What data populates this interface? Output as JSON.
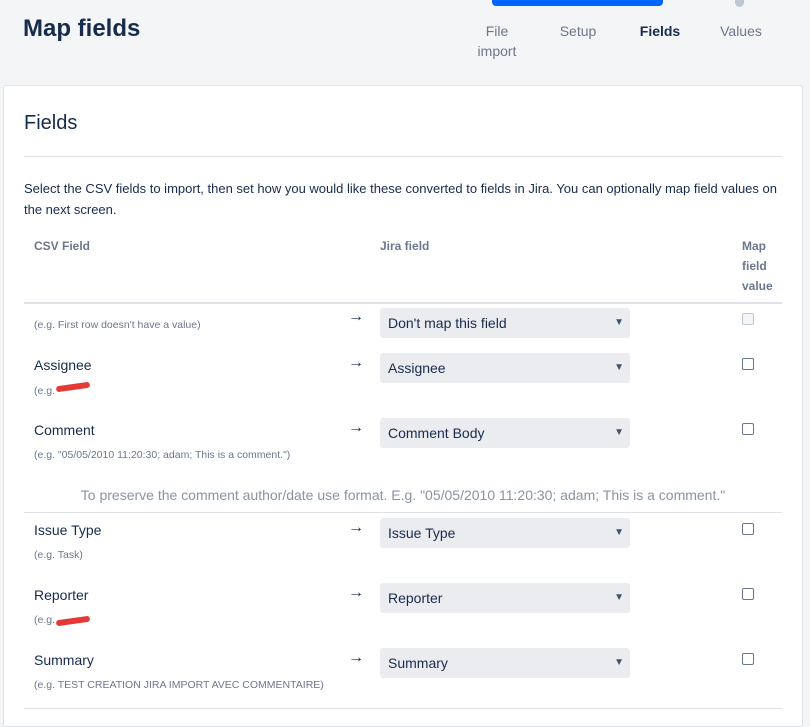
{
  "header": {
    "title": "Map fields",
    "steps": [
      {
        "label_line1": "File",
        "label_line2": "import"
      },
      {
        "label": "Setup"
      },
      {
        "label": "Fields"
      },
      {
        "label": "Values"
      }
    ]
  },
  "section": {
    "title": "Fields",
    "description": "Select the CSV fields to import, then set how you would like these converted to fields in Jira. You can optionally map field values on the next screen."
  },
  "table": {
    "headers": {
      "csv_field": "CSV Field",
      "jira_field": "Jira field",
      "map_value_line1": "Map",
      "map_value_line2": "field",
      "map_value_line3": "value"
    },
    "arrow": "→",
    "rows": [
      {
        "name": "",
        "example": "(e.g. First row doesn't have a value)",
        "mapping": "Don't map this field",
        "map_value": false,
        "disabled": true
      },
      {
        "name": "Assignee",
        "example": "(e.g.",
        "mapping": "Assignee",
        "map_value": false
      },
      {
        "name": "Comment",
        "example": "(e.g. \"05/05/2010 11:20:30; adam; This is a comment.\")",
        "mapping": "Comment Body",
        "map_value": false
      },
      {
        "name": "Issue Type",
        "example": "(e.g. Task)",
        "mapping": "Issue Type",
        "map_value": false
      },
      {
        "name": "Reporter",
        "example": "(e.g.",
        "mapping": "Reporter",
        "map_value": false
      },
      {
        "name": "Summary",
        "example": "(e.g. TEST CREATION JIRA IMPORT AVEC COMMENTAIRE)",
        "mapping": "Summary",
        "map_value": false
      }
    ],
    "comment_hint": "To preserve the comment author/date use format. E.g. \"05/05/2010 11:20:30; adam; This is a comment.\""
  },
  "icons": {
    "select_caret": "chevron-down-icon"
  },
  "colors": {
    "accent": "#0065ff",
    "select_bg": "#ebecf0",
    "muted_text": "#6b778c",
    "redaction": "#e53935"
  }
}
